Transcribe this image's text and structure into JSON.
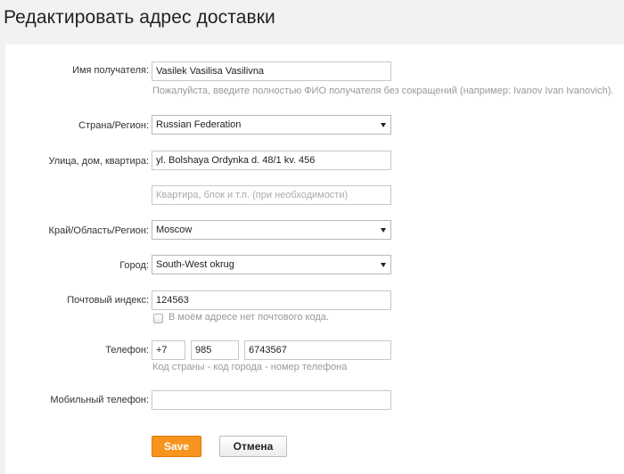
{
  "page": {
    "title": "Редактировать адрес доставки"
  },
  "form": {
    "recipient": {
      "label": "Имя получателя:",
      "value": "Vasilek Vasilisa Vasilivna",
      "hint": "Пожалуйста, введите полностью ФИО получателя без сокращений (например: Ivanov Ivan Ivanovich)."
    },
    "country": {
      "label": "Страна/Регион:",
      "selected": "Russian Federation"
    },
    "street": {
      "label": "Улица, дом, квартира:",
      "value": "yl. Bolshaya Ordynka d. 48/1 kv. 456"
    },
    "apartment": {
      "value": "",
      "placeholder": "Квартира, блок и т.п. (при необходимости)"
    },
    "region": {
      "label": "Край/Область/Регион:",
      "selected": "Moscow"
    },
    "city": {
      "label": "Город:",
      "selected": "South-West okrug"
    },
    "postal": {
      "label": "Почтовый индекс:",
      "value": "124563",
      "no_code_label": "В моём адресе нет почтового кода.",
      "no_code_checked": false
    },
    "phone": {
      "label": "Телефон:",
      "country_code": "+7",
      "city_code": "985",
      "number": "6743567",
      "hint": "Код страны - код города - номер телефона"
    },
    "mobile": {
      "label": "Мобильный телефон:",
      "value": ""
    }
  },
  "actions": {
    "save_label": "Save",
    "cancel_label": "Отмена"
  },
  "colors": {
    "save_button": "#f7941d",
    "hint_text": "#999999",
    "background": "#f2f2f2"
  }
}
